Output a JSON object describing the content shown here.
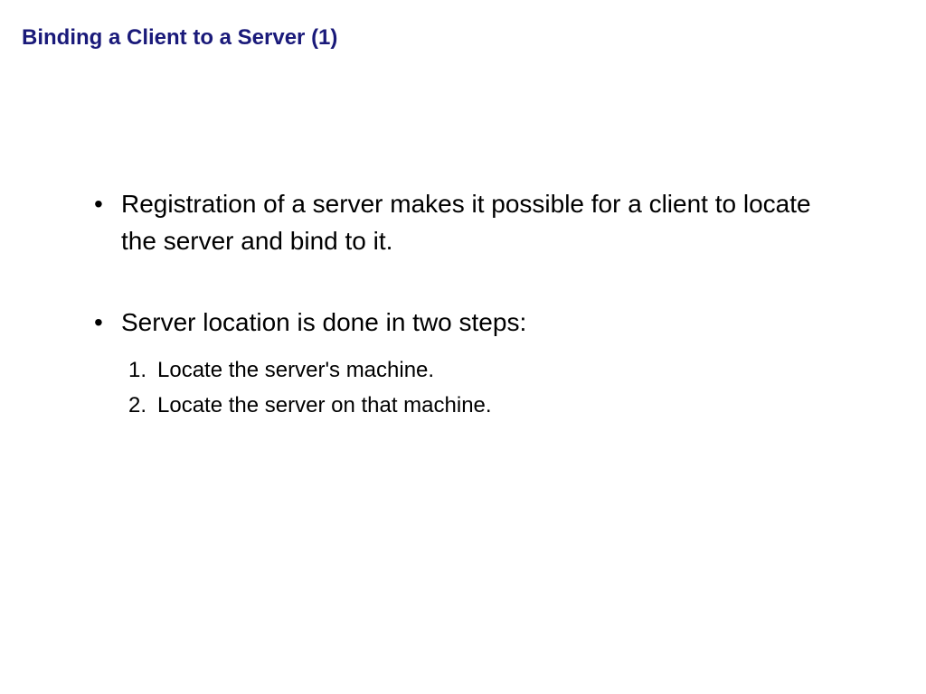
{
  "title": "Binding a Client to a Server (1)",
  "bullets": [
    {
      "text": "Registration of a server makes it possible for a client to locate the server and bind to it."
    },
    {
      "text": "Server location is done in two steps:",
      "subitems": [
        "Locate the server's machine.",
        "Locate the server on that machine."
      ]
    }
  ]
}
